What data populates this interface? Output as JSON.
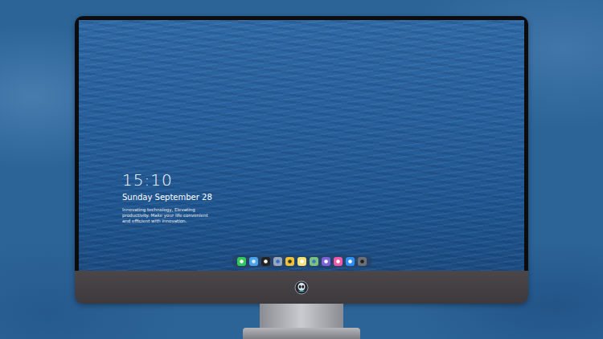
{
  "lock_screen": {
    "time": "15:10",
    "date": "Sunday September 28",
    "tagline": "Innovating technology, Elevating productivity. Make your life convenient and efficient with innovation."
  }
}
